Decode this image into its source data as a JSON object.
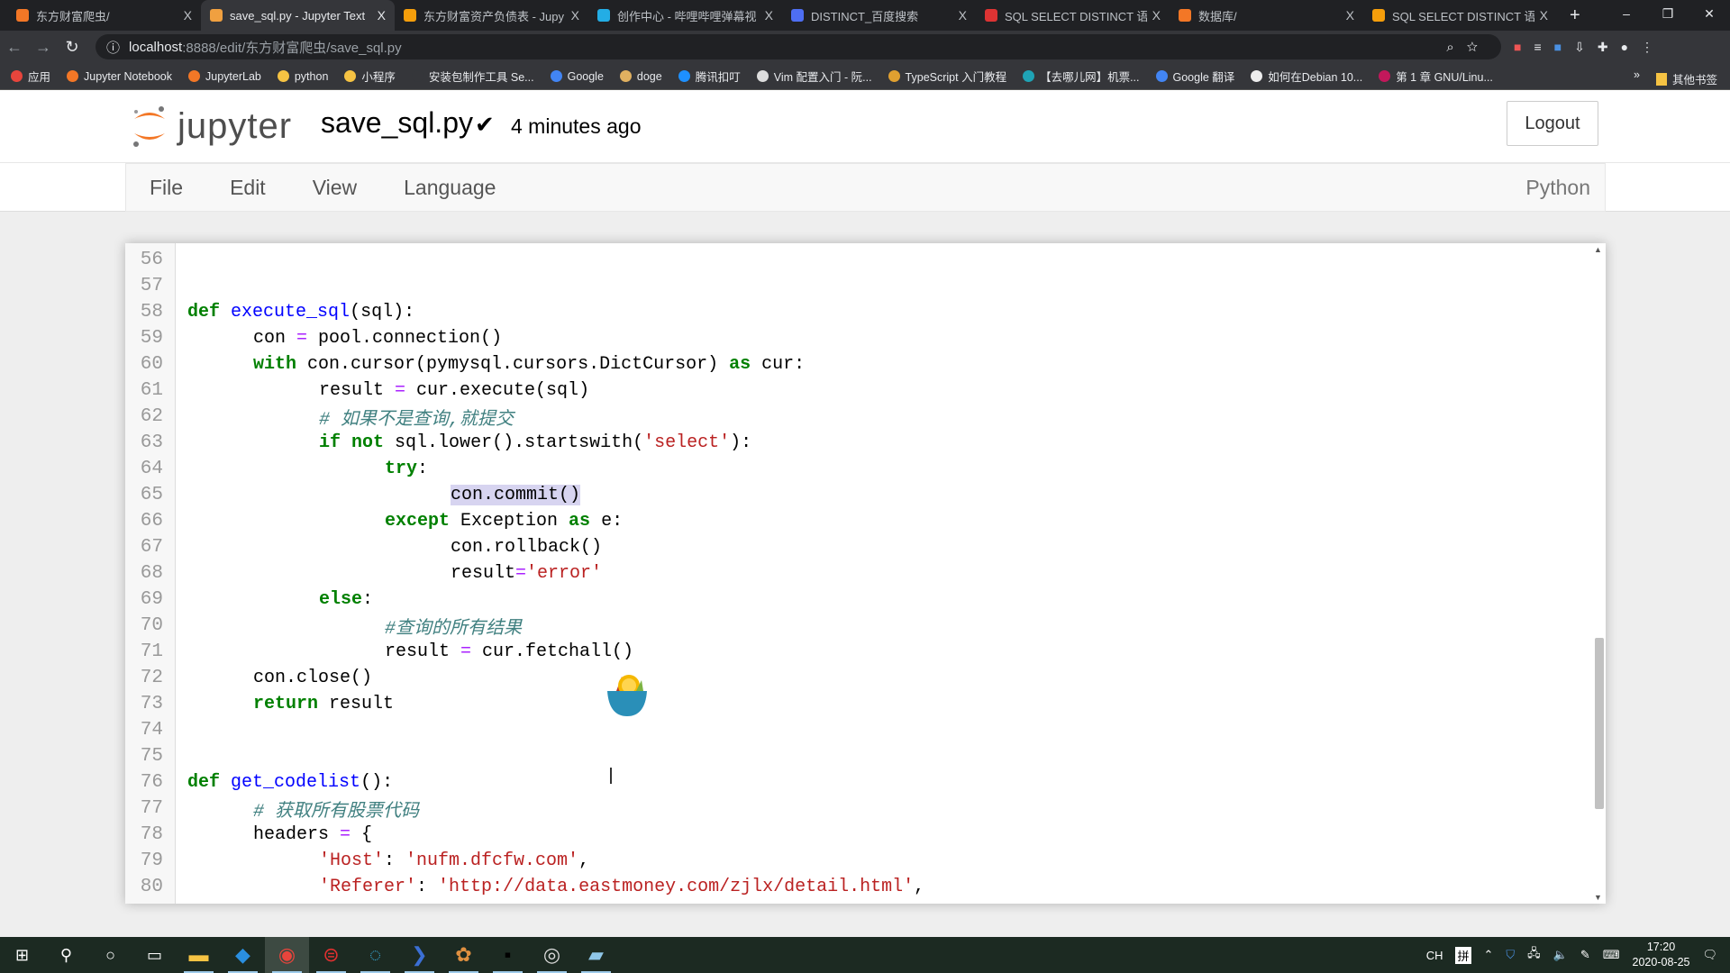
{
  "browser": {
    "tabs": [
      {
        "title": "东方财富爬虫/",
        "icon": "jupyter-icon",
        "color": "#f37726",
        "active": false
      },
      {
        "title": "save_sql.py - Jupyter Text",
        "icon": "file-icon",
        "color": "#f0a040",
        "active": true
      },
      {
        "title": "东方财富资产负债表 - Jupy",
        "icon": "notebook-icon",
        "color": "#f59e0b",
        "active": false
      },
      {
        "title": "创作中心 - 哔哩哔哩弹幕视",
        "icon": "bilibili-icon",
        "color": "#23ade5",
        "active": false
      },
      {
        "title": "DISTINCT_百度搜索",
        "icon": "baidu-icon",
        "color": "#4e6ef2",
        "active": false
      },
      {
        "title": "SQL SELECT DISTINCT 语句",
        "icon": "w3school-icon",
        "color": "#d33",
        "active": false
      },
      {
        "title": "数据库/",
        "icon": "jupyter-icon",
        "color": "#f37726",
        "active": false
      },
      {
        "title": "SQL SELECT DISTINCT 语句",
        "icon": "notebook-icon",
        "color": "#f59e0b",
        "active": false
      }
    ],
    "close_glyph": "X",
    "new_tab": "+",
    "window_controls": [
      "–",
      "❐",
      "✕"
    ],
    "url_host": "localhost",
    "url_rest": ":8888/edit/东方财富爬虫/save_sql.py",
    "bookmarks": [
      {
        "label": "应用",
        "color": "#e8453c"
      },
      {
        "label": "Jupyter Notebook",
        "color": "#f37726"
      },
      {
        "label": "JupyterLab",
        "color": "#f37726"
      },
      {
        "label": "python",
        "color": "#f6c343"
      },
      {
        "label": "小程序",
        "color": "#f6c343"
      },
      {
        "label": "安装包制作工具 Se...",
        "color": "#35363a"
      },
      {
        "label": "Google",
        "color": "#4285f4"
      },
      {
        "label": "doge",
        "color": "#e0b060"
      },
      {
        "label": "腾讯扣叮",
        "color": "#1e90ff"
      },
      {
        "label": "Vim 配置入门 - 阮...",
        "color": "#ddd"
      },
      {
        "label": "TypeScript 入门教程",
        "color": "#e0a030"
      },
      {
        "label": "【去哪儿网】机票...",
        "color": "#1fa3b5"
      },
      {
        "label": "Google 翻译",
        "color": "#4285f4"
      },
      {
        "label": "如何在Debian 10...",
        "color": "#eee"
      },
      {
        "label": "第 1 章 GNU/Linu...",
        "color": "#c2185b"
      }
    ],
    "bookmarks_more": "»",
    "other_bookmarks": "其他书签"
  },
  "jupyter": {
    "logo_text": "jupyter",
    "filename": "save_sql.py",
    "saved_check": "✔",
    "last_saved": "4 minutes ago",
    "logout": "Logout",
    "menu": [
      "File",
      "Edit",
      "View",
      "Language"
    ],
    "kernel": "Python"
  },
  "editor": {
    "lines": [
      {
        "n": "56",
        "indent": 0,
        "tokens": []
      },
      {
        "n": "57",
        "indent": 0,
        "tokens": []
      },
      {
        "n": "58",
        "indent": 0,
        "tokens": [
          [
            "k",
            "def"
          ],
          [
            "n",
            " "
          ],
          [
            "d",
            "execute_sql"
          ],
          [
            "n",
            "(sql):"
          ]
        ]
      },
      {
        "n": "59",
        "indent": 1,
        "tokens": [
          [
            "n",
            "con "
          ],
          [
            "o",
            "="
          ],
          [
            "n",
            " pool.connection()"
          ]
        ]
      },
      {
        "n": "60",
        "indent": 1,
        "tokens": [
          [
            "k",
            "with"
          ],
          [
            "n",
            " con.cursor(pymysql.cursors.DictCursor) "
          ],
          [
            "k",
            "as"
          ],
          [
            "n",
            " cur:"
          ]
        ]
      },
      {
        "n": "61",
        "indent": 2,
        "tokens": [
          [
            "n",
            "result "
          ],
          [
            "o",
            "="
          ],
          [
            "n",
            " cur.execute(sql)"
          ]
        ]
      },
      {
        "n": "62",
        "indent": 2,
        "tokens": [
          [
            "c",
            "# 如果不是查询,就提交"
          ]
        ]
      },
      {
        "n": "63",
        "indent": 2,
        "tokens": [
          [
            "k",
            "if"
          ],
          [
            "n",
            " "
          ],
          [
            "k",
            "not"
          ],
          [
            "n",
            " sql.lower().startswith("
          ],
          [
            "s",
            "'select'"
          ],
          [
            "n",
            "):"
          ]
        ]
      },
      {
        "n": "64",
        "indent": 3,
        "tokens": [
          [
            "k",
            "try"
          ],
          [
            "n",
            ":"
          ]
        ]
      },
      {
        "n": "65",
        "indent": 4,
        "tokens": [
          [
            "h",
            "con.commit()"
          ]
        ]
      },
      {
        "n": "66",
        "indent": 3,
        "tokens": [
          [
            "k",
            "except"
          ],
          [
            "n",
            " Exception "
          ],
          [
            "k",
            "as"
          ],
          [
            "n",
            " e:"
          ]
        ]
      },
      {
        "n": "67",
        "indent": 4,
        "tokens": [
          [
            "n",
            "con.rollback()"
          ]
        ]
      },
      {
        "n": "68",
        "indent": 4,
        "tokens": [
          [
            "n",
            "result"
          ],
          [
            "o",
            "="
          ],
          [
            "s",
            "'error'"
          ]
        ]
      },
      {
        "n": "69",
        "indent": 2,
        "tokens": [
          [
            "k",
            "else"
          ],
          [
            "n",
            ":"
          ]
        ]
      },
      {
        "n": "70",
        "indent": 3,
        "tokens": [
          [
            "c",
            "#查询的所有结果"
          ]
        ]
      },
      {
        "n": "71",
        "indent": 3,
        "tokens": [
          [
            "n",
            "result "
          ],
          [
            "o",
            "="
          ],
          [
            "n",
            " cur.fetchall()"
          ]
        ]
      },
      {
        "n": "72",
        "indent": 1,
        "tokens": [
          [
            "n",
            "con.close()"
          ]
        ]
      },
      {
        "n": "73",
        "indent": 1,
        "tokens": [
          [
            "k",
            "return"
          ],
          [
            "n",
            " result"
          ]
        ]
      },
      {
        "n": "74",
        "indent": 0,
        "tokens": []
      },
      {
        "n": "75",
        "indent": 0,
        "tokens": []
      },
      {
        "n": "76",
        "indent": 0,
        "tokens": [
          [
            "k",
            "def"
          ],
          [
            "n",
            " "
          ],
          [
            "d",
            "get_codelist"
          ],
          [
            "n",
            "():"
          ]
        ]
      },
      {
        "n": "77",
        "indent": 1,
        "tokens": [
          [
            "c",
            "# 获取所有股票代码"
          ]
        ]
      },
      {
        "n": "78",
        "indent": 1,
        "tokens": [
          [
            "n",
            "headers "
          ],
          [
            "o",
            "="
          ],
          [
            "n",
            " {"
          ]
        ]
      },
      {
        "n": "79",
        "indent": 2,
        "tokens": [
          [
            "s",
            "'Host'"
          ],
          [
            "n",
            ": "
          ],
          [
            "s",
            "'nufm.dfcfw.com'"
          ],
          [
            "n",
            ","
          ]
        ]
      },
      {
        "n": "80",
        "indent": 2,
        "tokens": [
          [
            "s",
            "'Referer'"
          ],
          [
            "n",
            ": "
          ],
          [
            "s",
            "'http://data.eastmoney.com/zjlx/detail.html'"
          ],
          [
            "n",
            ","
          ]
        ]
      }
    ],
    "scroll_up": "▲",
    "scroll_down": "▼"
  },
  "taskbar": {
    "apps": [
      "file-explorer-icon",
      "vscode-icon",
      "chrome-icon",
      "netease-music-icon",
      "qq-browser-icon",
      "powershell-icon",
      "anaconda-navigator-icon",
      "terminal-icon",
      "obs-icon",
      "notepad-icon"
    ],
    "ime_lang": "CH",
    "ime_mode": "拼",
    "time": "17:20",
    "date": "2020-08-25"
  },
  "colors": {
    "keyword": "#008000",
    "def": "#0000ff",
    "string": "#ba2121",
    "comment": "#408080",
    "jupyter_orange": "#f37726"
  }
}
